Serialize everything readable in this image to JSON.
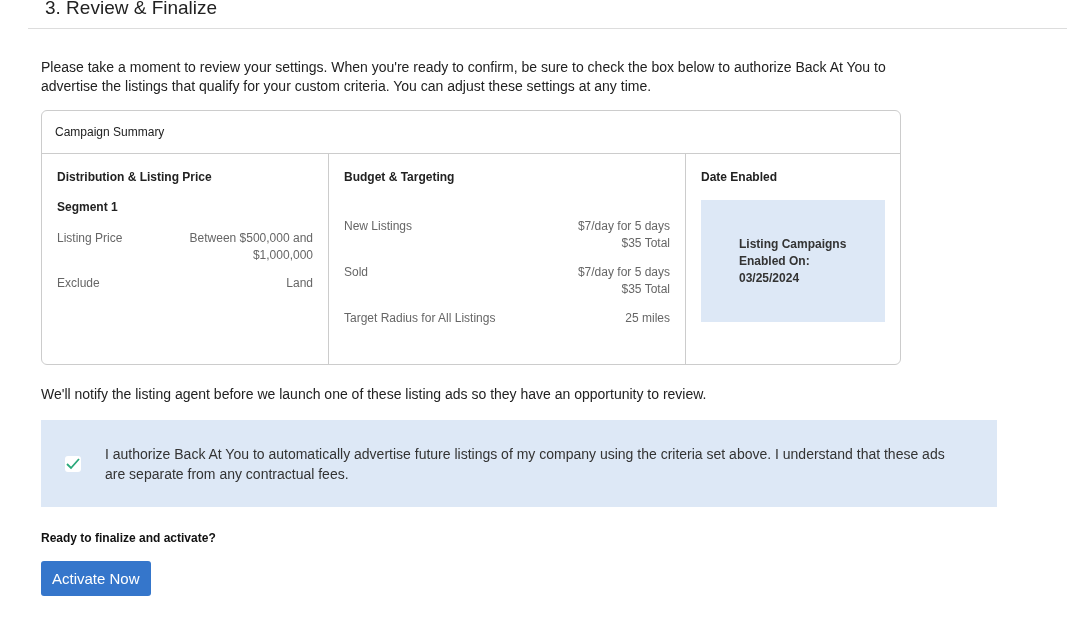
{
  "heading": "3. Review & Finalize",
  "intro": "Please take a moment to review your settings. When you're ready to confirm, be sure to check the box below to authorize Back At You to advertise the listings that qualify for your custom criteria. You can adjust these settings at any time.",
  "summary": {
    "title": "Campaign Summary",
    "distribution": {
      "title": "Distribution & Listing Price",
      "segment": "Segment 1",
      "rows": [
        {
          "label": "Listing Price",
          "value": "Between $500,000 and $1,000,000"
        },
        {
          "label": "Exclude",
          "value": "Land"
        }
      ]
    },
    "budget": {
      "title": "Budget & Targeting",
      "rows": [
        {
          "label": "New Listings",
          "value": "$7/day for 5 days",
          "total": "$35 Total"
        },
        {
          "label": "Sold",
          "value": "$7/day for 5 days",
          "total": "$35 Total"
        },
        {
          "label": "Target Radius for All Listings",
          "value": "25 miles"
        }
      ]
    },
    "date": {
      "title": "Date Enabled",
      "lines": [
        "Listing Campaigns",
        "Enabled On:",
        "03/25/2024"
      ]
    }
  },
  "notice": "We'll notify the listing agent before we launch one of these listing ads so they have an opportunity to review.",
  "authorization": {
    "checked": true,
    "text": "I authorize Back At You to automatically advertise future listings of my company using the criteria set above. I understand that these ads are separate from any contractual fees."
  },
  "ready": "Ready to finalize and activate?",
  "button": "Activate Now"
}
